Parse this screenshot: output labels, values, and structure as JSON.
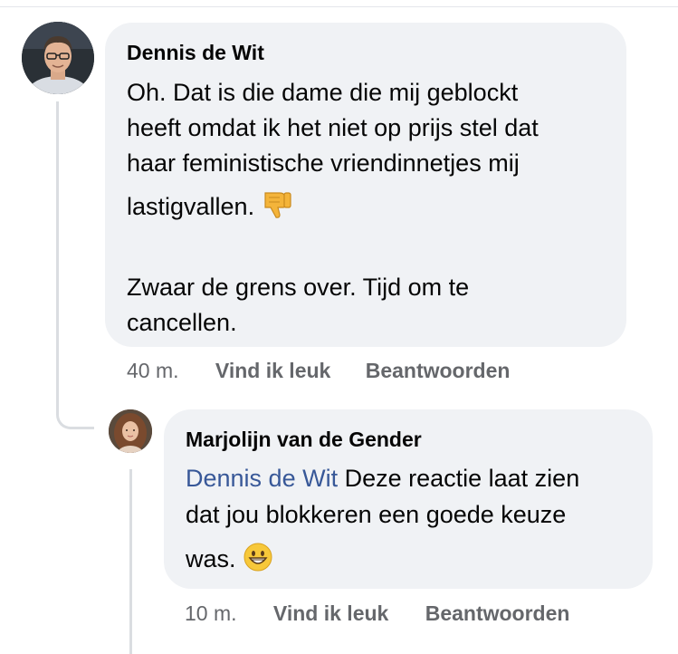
{
  "comment": {
    "author": "Dennis de Wit",
    "text_lines": [
      "Oh. Dat is die dame die mij geblockt",
      "heeft omdat ik het niet op prijs stel dat",
      "haar feministische vriendinnetjes mij",
      "lastigvallen."
    ],
    "emoji": "thumbs-down",
    "text_second_paragraph_lines": [
      "Zwaar de grens over. Tijd om te",
      "cancellen."
    ],
    "time": "40 m.",
    "like_label": "Vind ik leuk",
    "reply_label": "Beantwoorden"
  },
  "reply": {
    "author": "Marjolijn van de Gender",
    "mention": "Dennis de Wit",
    "text_lines": [
      " Deze reactie laat zien",
      "dat jou blokkeren een goede keuze",
      "was."
    ],
    "emoji": "grinning-face",
    "time": "10 m.",
    "like_label": "Vind ik leuk",
    "reply_label": "Beantwoorden"
  },
  "colors": {
    "bubble": "#f0f2f5",
    "text": "#050505",
    "meta": "#65676b",
    "mention": "#385898",
    "thread_line": "#dadde1"
  }
}
